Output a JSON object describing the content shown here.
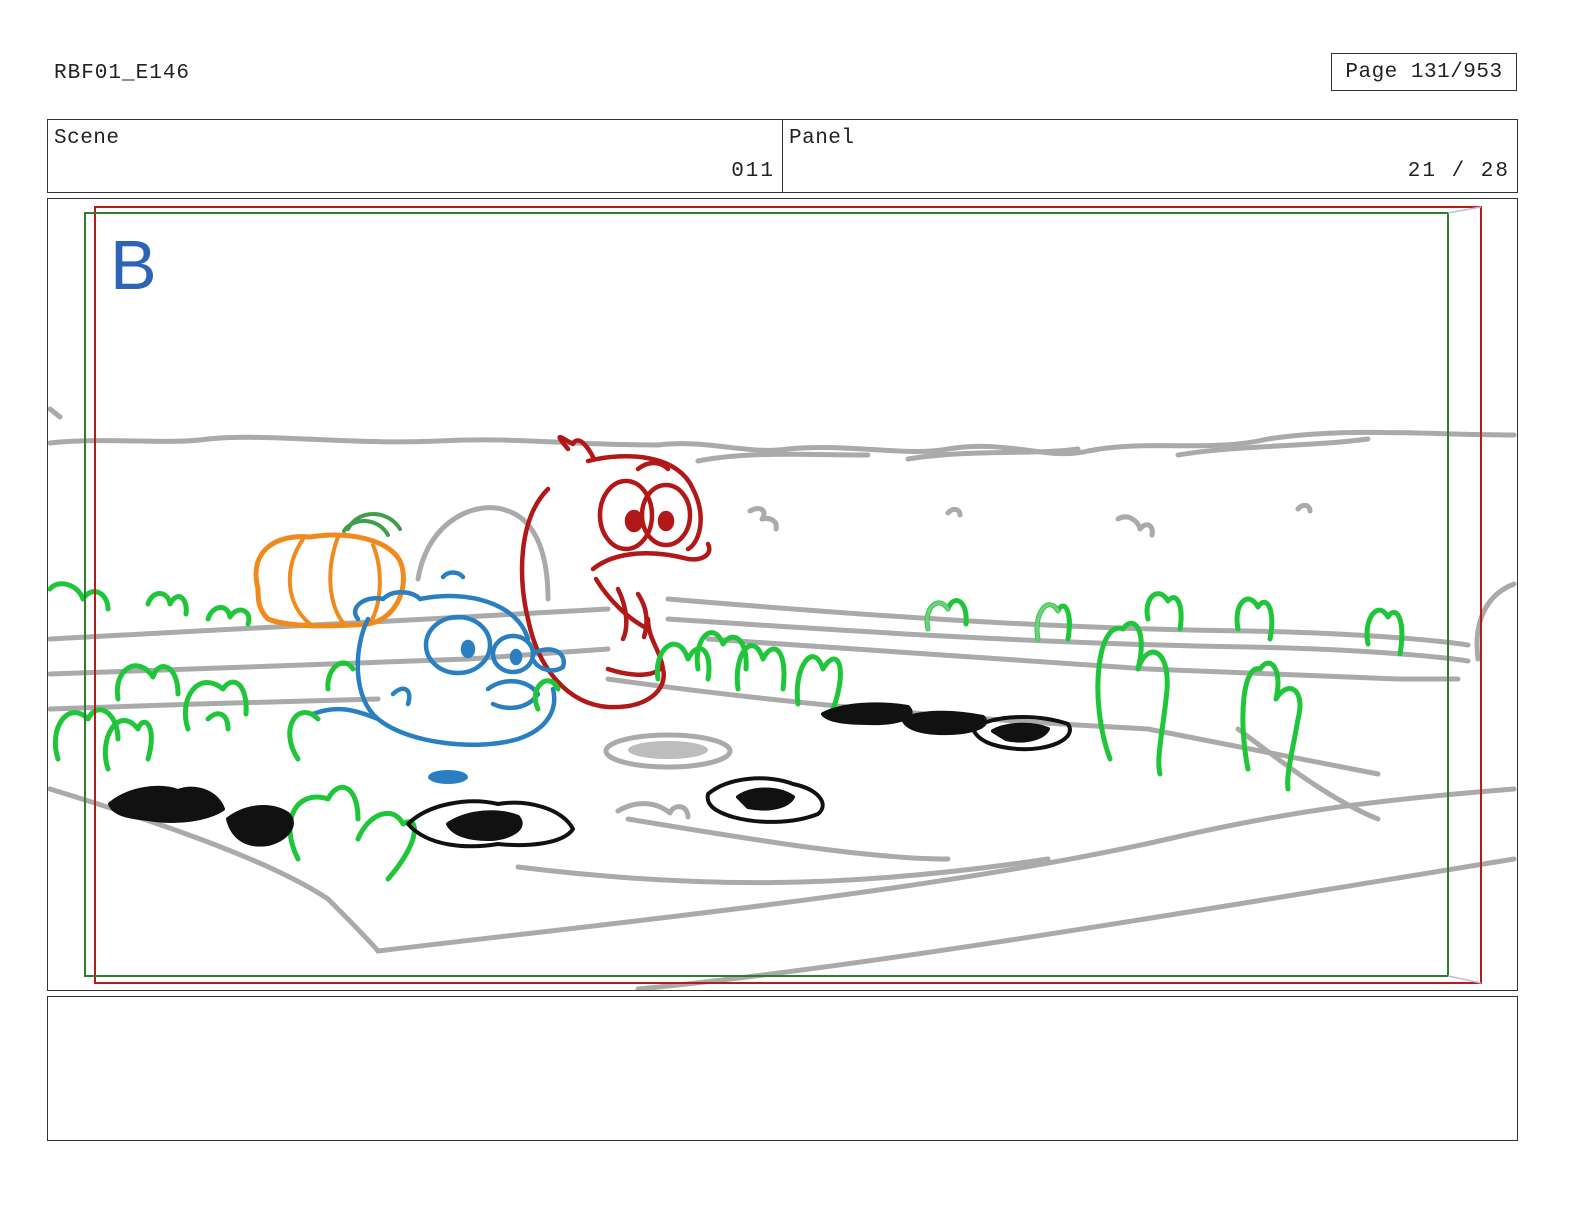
{
  "header": {
    "document_id": "RBF01_E146",
    "page_label": "Page 131/953"
  },
  "info": {
    "scene_label": "Scene",
    "scene_value": "011",
    "panel_label": "Panel",
    "panel_value": "21 / 28"
  },
  "panel": {
    "marker_letter": "B",
    "colors": {
      "safe_frame_green": "#2e7d32",
      "action_frame_red": "#b71c1c",
      "marker_blue": "#2d64b8",
      "background_gray": "#aaaaaa",
      "plant_green": "#1fc63a",
      "character_red": "#b21818",
      "character_blue": "#2a7fc1",
      "pumpkin_orange": "#f08a1c",
      "holes_black": "#111111"
    },
    "elements": [
      "fence-line",
      "garden-bed",
      "pumpkin",
      "red-character",
      "blue-character",
      "sprouts",
      "dirt-holes"
    ]
  },
  "notes": {
    "text": ""
  }
}
